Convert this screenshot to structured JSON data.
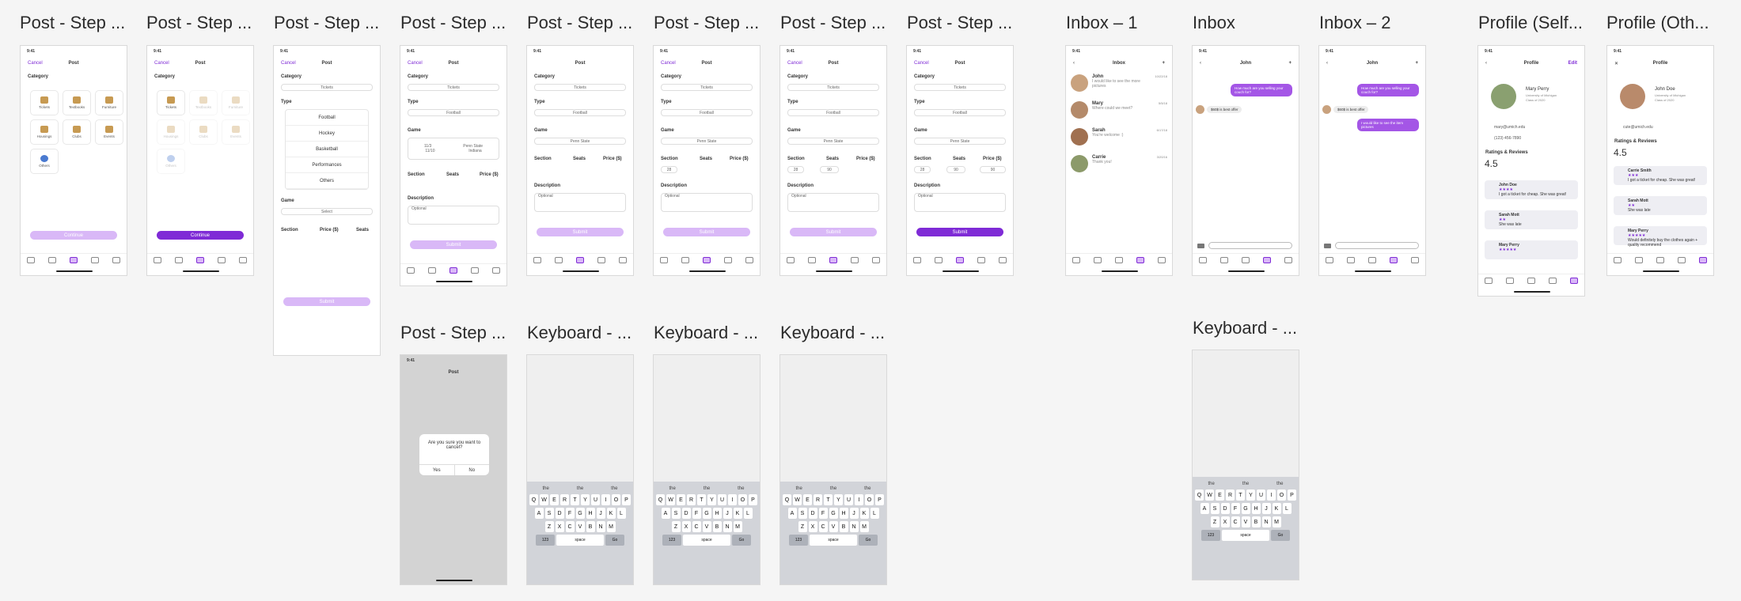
{
  "frame_titles": {
    "f1": "Post - Step ...",
    "f2": "Post - Step ...",
    "f3": "Post - Step ...",
    "f4": "Post - Step ...",
    "f5": "Post - Step ...",
    "f6": "Post - Step ...",
    "f7": "Post - Step ...",
    "f8": "Post - Step ...",
    "f9": "Inbox – 1",
    "f10": "Inbox",
    "f11": "Inbox – 2",
    "f12": "Profile (Self...",
    "f13": "Profile (Oth...",
    "f14": "Post - Step ...",
    "f15": "Keyboard - ...",
    "f16": "Keyboard - ...",
    "f17": "Keyboard - ...",
    "f18": "Keyboard - ..."
  },
  "status_time": "9:41",
  "post": {
    "cancel": "Cancel",
    "title": "Post",
    "category": "Category",
    "type": "Type",
    "game": "Game",
    "section": "Section",
    "seats": "Seats",
    "price": "Price ($)",
    "description": "Description",
    "optional": "Optional",
    "continue": "Continue",
    "submit": "Submit",
    "tickets_value": "Tickets",
    "football": "Football",
    "select": "Select",
    "penn_state": "Penn State",
    "indiana": "Indiana",
    "date1": "11/3",
    "date2": "11/10",
    "sec_value": "28",
    "seats_value": "90",
    "price_value": "90"
  },
  "categories": [
    "Tickets",
    "Textbooks",
    "Furniture",
    "Housings",
    "Clubs",
    "Events",
    "Others"
  ],
  "types": [
    "Football",
    "Hockey",
    "Basketball",
    "Performances",
    "Others"
  ],
  "dialog": {
    "question": "Are you sure you want to cancel?",
    "yes": "Yes",
    "no": "No"
  },
  "inbox": {
    "title": "Inbox",
    "threads": [
      {
        "name": "John",
        "preview": "I would like to see the more pictures",
        "date": "10/22/18"
      },
      {
        "name": "Mary",
        "preview": "Where could we meet?",
        "date": "5/5/18"
      },
      {
        "name": "Sarah",
        "preview": "You're welcome :)",
        "date": "6/17/18"
      },
      {
        "name": "Carrie",
        "preview": "Thank you!",
        "date": "3/20/16"
      }
    ]
  },
  "chat": {
    "name": "John",
    "msg_out": "How much are you selling your couch for?",
    "msg_in": "$60$ is best offer",
    "msg_out2": "I would like to see the item pictures"
  },
  "profile_self": {
    "title": "Profile",
    "edit": "Edit",
    "name": "Mary Perry",
    "school": "University of Michigan",
    "class": "Class of 2020",
    "email": "mary@umich.edu",
    "phone": "(123) 456-7890",
    "ratings": "Ratings & Reviews",
    "score": "4.5",
    "reviews": [
      {
        "name": "John Doe",
        "text": "I got a ticket for cheap. She was great!"
      },
      {
        "name": "Sarah Mott",
        "text": "She was late"
      },
      {
        "name": "Mary Perry",
        "text": ""
      }
    ]
  },
  "profile_other": {
    "title": "Profile",
    "name": "John Doe",
    "school": "University of Michigan",
    "class": "Class of 2020",
    "email": "cute@umich.edu",
    "ratings": "Ratings & Reviews",
    "score": "4.5",
    "reviews": [
      {
        "name": "Carrie Smith",
        "text": "I got a ticket for cheap. She was great!"
      },
      {
        "name": "Sarah Mott",
        "text": "She was late"
      },
      {
        "name": "Mary Perry",
        "text": "Would definitely buy the clothes again + quality recommend"
      }
    ]
  },
  "keyboard": {
    "suggestions": [
      "the",
      "the",
      "the"
    ],
    "row1": [
      "Q",
      "W",
      "E",
      "R",
      "T",
      "Y",
      "U",
      "I",
      "O",
      "P"
    ],
    "row2": [
      "A",
      "S",
      "D",
      "F",
      "G",
      "H",
      "J",
      "K",
      "L"
    ],
    "row3": [
      "Z",
      "X",
      "C",
      "V",
      "B",
      "N",
      "M"
    ],
    "num": "123",
    "space": "space",
    "go": "Go"
  },
  "colors": {
    "accent": "#7f2bd6",
    "accent_light": "#d9b8f7"
  }
}
